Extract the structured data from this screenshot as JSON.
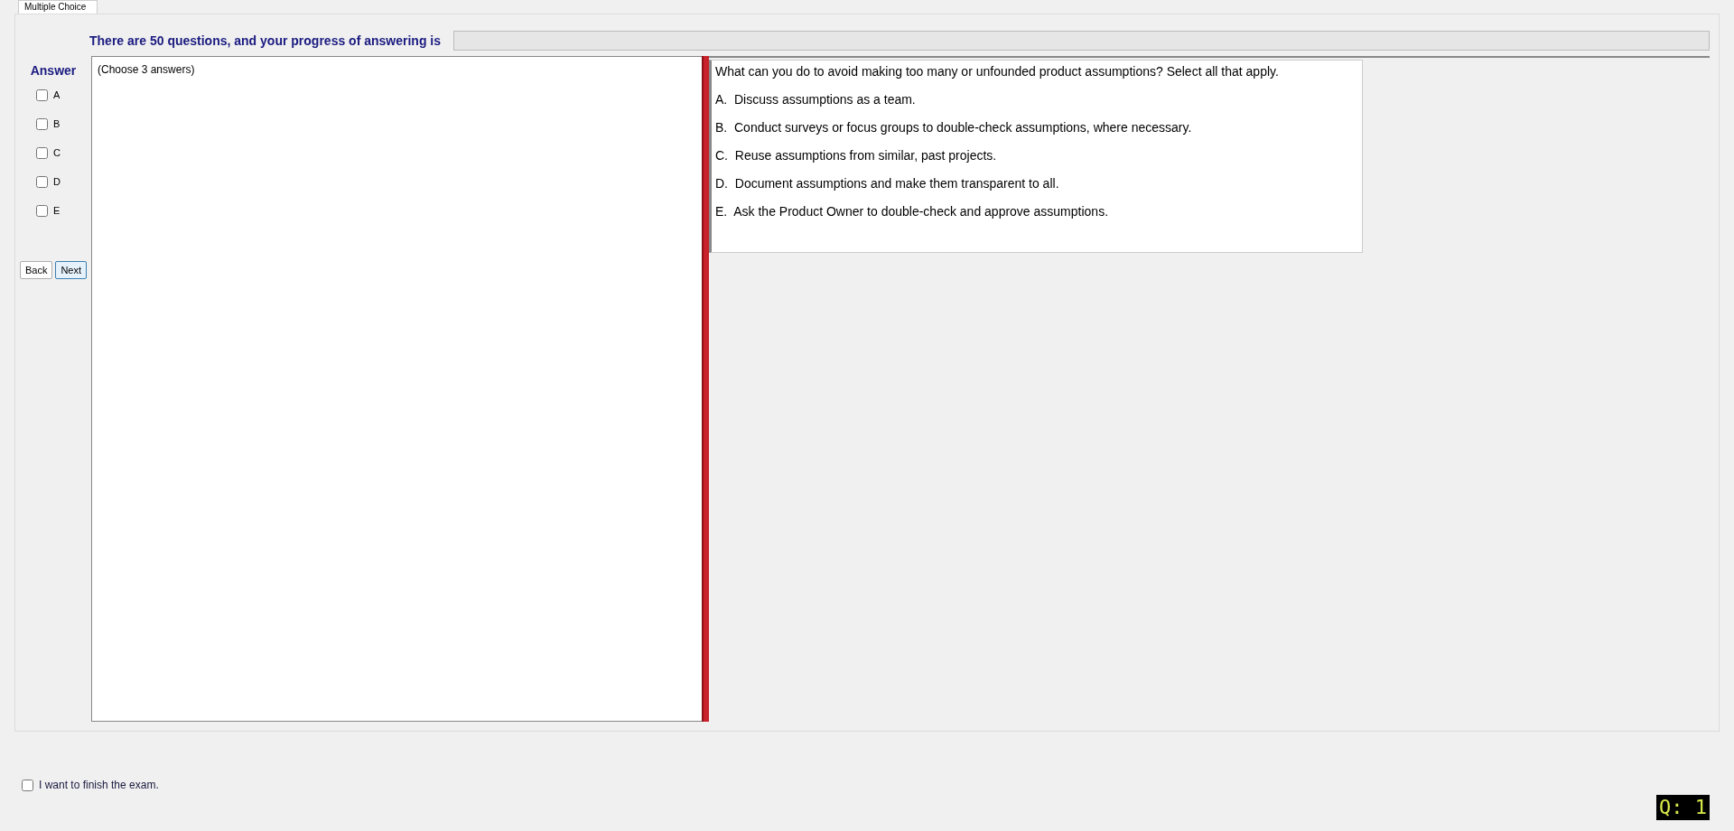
{
  "tab": {
    "label": "Multiple Choice"
  },
  "progress": {
    "text": "There are 50 questions, and your progress of answering is",
    "level": 0
  },
  "answer_panel": {
    "title": "Answer",
    "options": [
      {
        "label": "A",
        "checked": false
      },
      {
        "label": "B",
        "checked": false
      },
      {
        "label": "C",
        "checked": false
      },
      {
        "label": "D",
        "checked": false
      },
      {
        "label": "E",
        "checked": false
      }
    ]
  },
  "buttons": [
    {
      "label": "Back",
      "selected": false
    },
    {
      "label": "Next",
      "selected": true
    }
  ],
  "instruction": "(Choose 3 answers)",
  "question": {
    "text": "What can you do to avoid making too many or unfounded product assumptions? Select all that apply.",
    "choices": [
      {
        "letter": "A.",
        "text": "Discuss assumptions as a team."
      },
      {
        "letter": "B.",
        "text": "Conduct surveys or focus groups to double-check assumptions, where necessary."
      },
      {
        "letter": "C.",
        "text": "Reuse assumptions from similar, past projects."
      },
      {
        "letter": "D.",
        "text": "Document assumptions and make them transparent to all."
      },
      {
        "letter": "E.",
        "text": "Ask the Product Owner to double-check and approve assumptions."
      }
    ]
  },
  "finish": {
    "label": "I want to finish the exam.",
    "checked": false
  },
  "question_number": "Q: 1"
}
